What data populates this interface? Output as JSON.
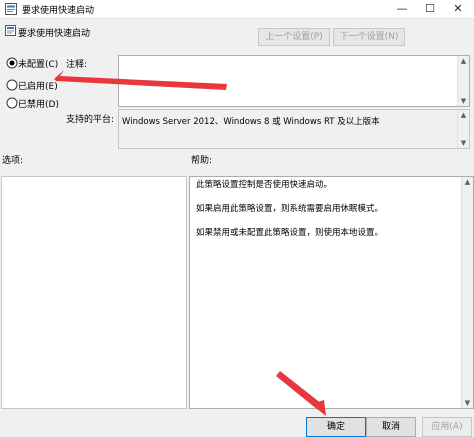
{
  "window": {
    "title": "要求使用快速启动",
    "minimize_glyph": "—",
    "maximize_glyph": "☐",
    "close_glyph": "✕"
  },
  "policy": {
    "name": "要求使用快速启动"
  },
  "nav": {
    "previous": "上一个设置(P)",
    "next": "下一个设置(N)"
  },
  "state_options": [
    {
      "label": "未配置(C)",
      "checked": true
    },
    {
      "label": "已启用(E)",
      "checked": false
    },
    {
      "label": "已禁用(D)",
      "checked": false
    }
  ],
  "comment": {
    "label": "注释:",
    "value": ""
  },
  "platform": {
    "label": "支持的平台:",
    "value": "Windows Server 2012、Windows 8 或 Windows RT 及以上版本"
  },
  "options_section": {
    "label": "选项:"
  },
  "help_section": {
    "label": "帮助:",
    "paragraphs": [
      "此策略设置控制是否使用快速启动。",
      "如果启用此策略设置，则系统需要启用休眠模式。",
      "如果禁用或未配置此策略设置，则使用本地设置。"
    ]
  },
  "buttons": {
    "ok": "确定",
    "cancel": "取消",
    "apply": "应用(A)"
  },
  "colors": {
    "annotation_arrow": "#e8383d",
    "accent": "#0078d7"
  }
}
